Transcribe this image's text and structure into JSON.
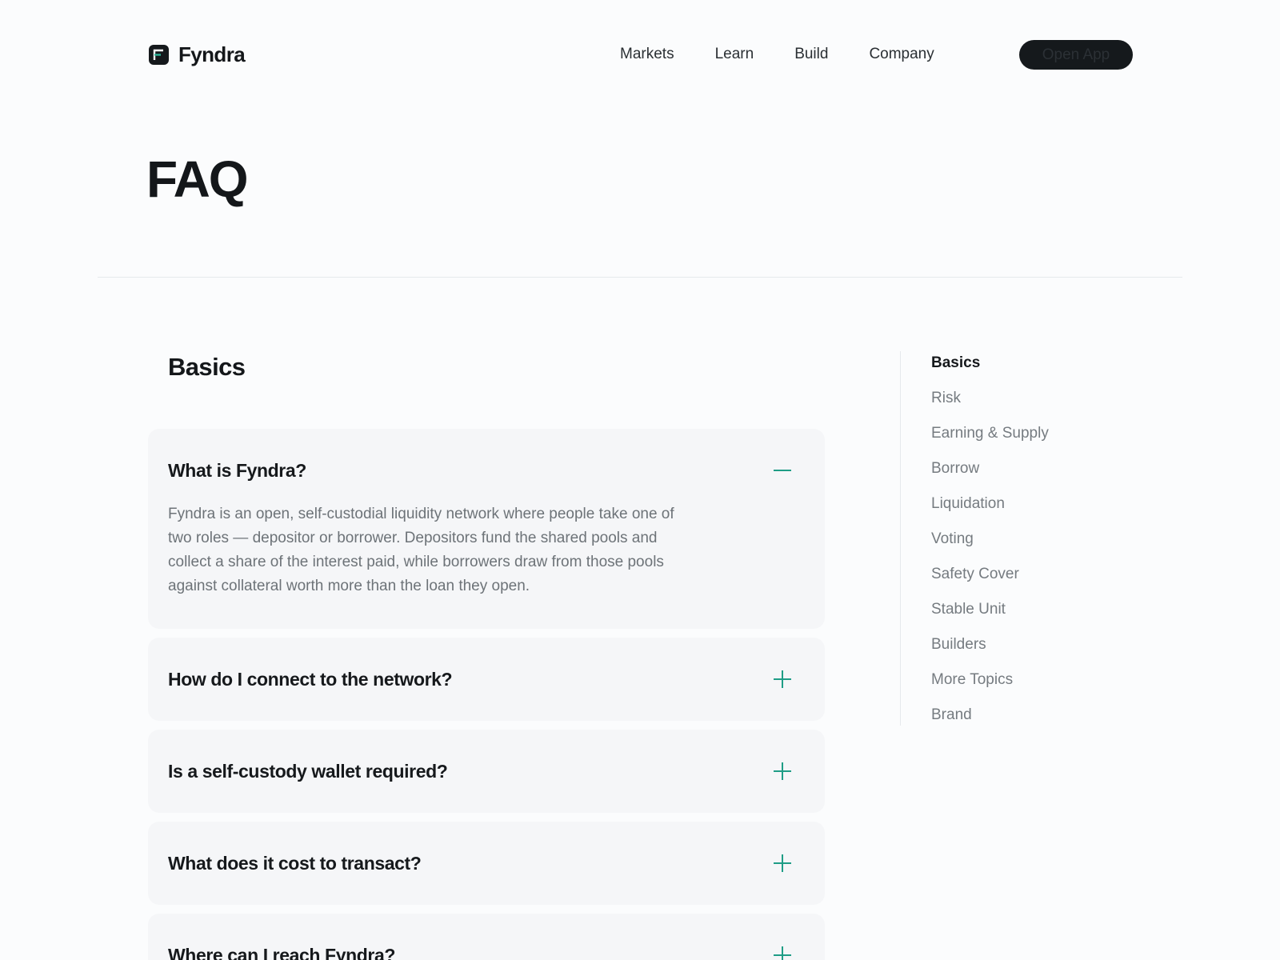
{
  "header": {
    "brand": "Fyndra",
    "nav": [
      "Markets",
      "Learn",
      "Build",
      "Company"
    ],
    "cta": "Open App"
  },
  "page": {
    "title": "FAQ"
  },
  "section": {
    "title": "Basics"
  },
  "faq": [
    {
      "question": "What is Fyndra?",
      "answer": "Fyndra is an open, self-custodial liquidity network where people take one of two roles — depositor or borrower. Depositors fund the shared pools and collect a share of the interest paid, while borrowers draw from those pools against collateral worth more than the loan they open.",
      "expanded": true
    },
    {
      "question": "How do I connect to the network?",
      "expanded": false
    },
    {
      "question": "Is a self-custody wallet required?",
      "expanded": false
    },
    {
      "question": "What does it cost to transact?",
      "expanded": false
    },
    {
      "question": "Where can I reach Fyndra?",
      "expanded": false
    }
  ],
  "toc": {
    "active": "Basics",
    "items": [
      "Basics",
      "Risk",
      "Earning & Supply",
      "Borrow",
      "Liquidation",
      "Voting",
      "Safety Cover",
      "Stable Unit",
      "Builders",
      "More Topics",
      "Brand"
    ]
  },
  "colors": {
    "accent": "#1f9d86",
    "dark": "#15191c",
    "card": "#f5f6f8"
  },
  "icons": {
    "expanded": "minus-icon",
    "collapsed": "plus-icon",
    "logo": "fyndra-logo-icon"
  }
}
